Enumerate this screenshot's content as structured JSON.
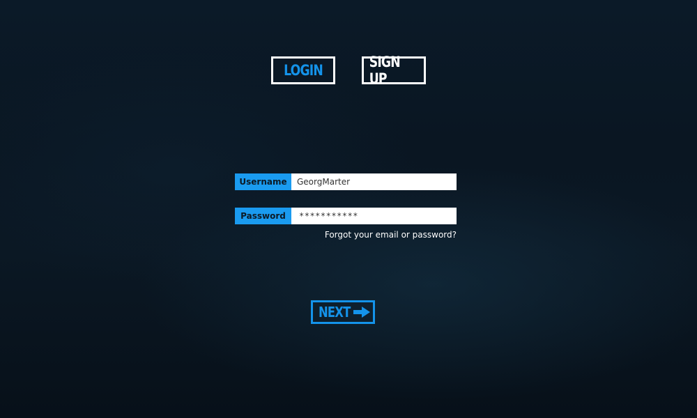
{
  "tabs": {
    "login_label": "LOGIN",
    "signup_label": "SIGN UP"
  },
  "form": {
    "username": {
      "label": "Username",
      "value": "GeorgMarter"
    },
    "password": {
      "label": "Password",
      "value": "***********"
    },
    "forgot_link": "Forgot your email or password?"
  },
  "next_button": {
    "label": "NEXT",
    "icon": "arrow-right-icon"
  },
  "colors": {
    "accent": "#1493ea",
    "label_bg": "#1a9bf0",
    "background": "#0a1622",
    "text": "#ffffff"
  }
}
